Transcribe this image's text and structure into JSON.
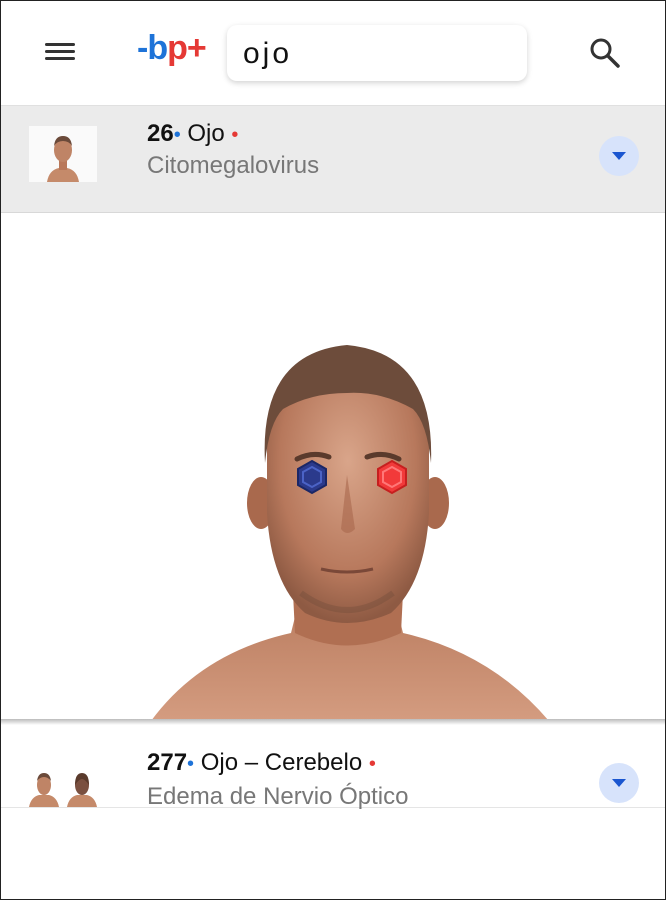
{
  "header": {
    "logo": {
      "dash": "-",
      "b": "b",
      "p": "p",
      "plus": "+"
    },
    "search_value": "ojo",
    "icons": {
      "menu": "menu-icon",
      "search": "search-icon"
    }
  },
  "results": [
    {
      "number": "26",
      "dot": "•",
      "title": "Ojo",
      "marker": "•",
      "subtitle": "Citomegalovirus"
    },
    {
      "number": "277",
      "dot": "•",
      "title": "Ojo – Cerebelo",
      "marker": "•",
      "subtitle": "Edema de Nervio Óptico"
    }
  ],
  "colors": {
    "blue": "#1e73d8",
    "red": "#e53935",
    "expand_bg": "#d7e3fb"
  }
}
